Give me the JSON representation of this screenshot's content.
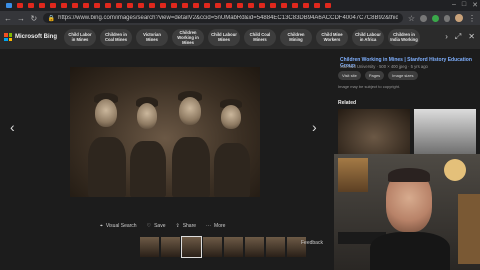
{
  "browser": {
    "url": "https://www.bing.com/images/search?view=detailV2&ccid=5nUMabRd&id=54884EC13C83DB94A6ACCDF40047C7C8B92&thid=OIP.5nUMabRdn3hr...",
    "tab_count": 30
  },
  "bing": {
    "logo_text": "Microsoft Bing",
    "chips": [
      "Child Labor in Mines",
      "Children in Coal Mines",
      "Victorian Mines",
      "Children Working in Mines",
      "Child Labour Mines",
      "Child Coal Miners",
      "Children Mining",
      "Child Mine Workers",
      "Child Labour in Africa",
      "Children in India Working"
    ]
  },
  "viewer": {
    "actions": [
      "Visual Search",
      "Save",
      "Share",
      "More"
    ],
    "feedback": "Feedback",
    "thumbnails_count": 8,
    "selected_thumbnail": 2
  },
  "side_panel": {
    "title": "Children Working in Mines | Stanford History Education Group",
    "source": "Stanford University · 500 × 400 jpeg · 5 yrs ago",
    "buttons": [
      "Visit site",
      "Pages",
      "Image sizes"
    ],
    "copyright": "Image may be subject to copyright.",
    "related_label": "Related"
  },
  "colors": {
    "accent": "#7fb0ff",
    "background": "#1c1c1c"
  }
}
